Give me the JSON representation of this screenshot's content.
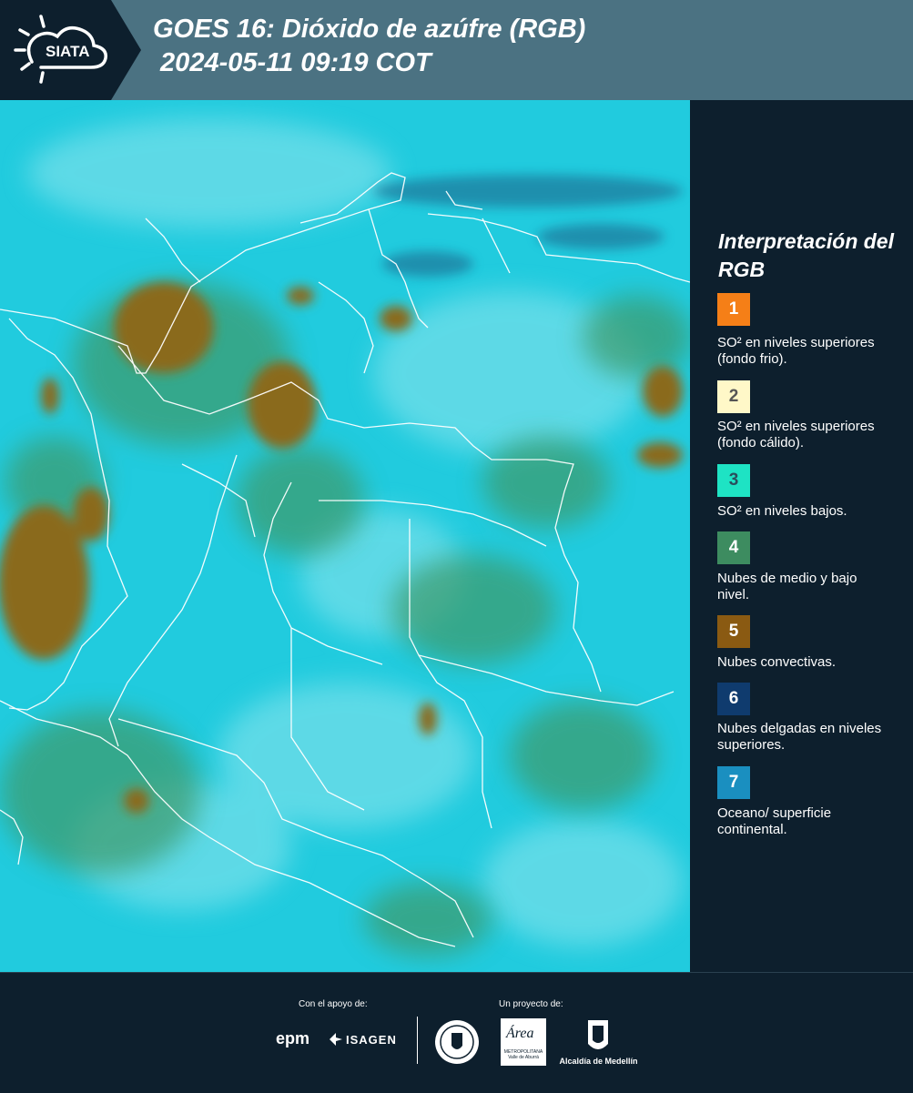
{
  "header": {
    "logo_text": "SIATA",
    "title": "GOES 16: Dióxido de azúfre (RGB)\n 2024-05-11 09:19 COT"
  },
  "map": {
    "map_type": "satellite RGB sulfur dioxide composite",
    "boundaries_color": "#ffffff",
    "base_color": "#20cfe0"
  },
  "legend": {
    "title": "Interpretación del RGB",
    "items": [
      {
        "num": "1",
        "color": "#f57f17",
        "num_color": "#ffffff",
        "text": "SO² en niveles superiores (fondo frio)."
      },
      {
        "num": "2",
        "color": "#fff8c8",
        "num_color": "#555555",
        "text": "SO² en niveles superiores (fondo cálido)."
      },
      {
        "num": "3",
        "color": "#1ee3c4",
        "num_color": "#2a4e5c",
        "text": "SO² en niveles bajos."
      },
      {
        "num": "4",
        "color": "#3d8c60",
        "num_color": "#ffffff",
        "text": "Nubes de medio y bajo nivel."
      },
      {
        "num": "5",
        "color": "#8a5a12",
        "num_color": "#ffffff",
        "text": "Nubes convectivas."
      },
      {
        "num": "6",
        "color": "#0f3b6e",
        "num_color": "#ffffff",
        "text": "Nubes delgadas en niveles superiores."
      },
      {
        "num": "7",
        "color": "#1a8fc0",
        "num_color": "#ffffff",
        "text": "Oceano/ superficie continental."
      }
    ]
  },
  "footer": {
    "support_label": "Con el apoyo de:",
    "project_label": "Un proyecto de:",
    "sponsor_1": "epm",
    "sponsor_2": "ISAGEN",
    "partner_2": "Área",
    "partner_2_sub": "METROPOLITANA Valle de Aburrá",
    "partner_3": "Alcaldía de Medellín"
  }
}
